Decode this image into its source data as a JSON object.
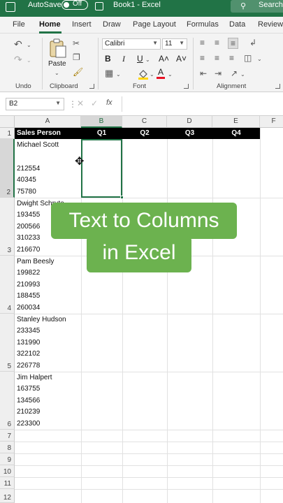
{
  "titlebar": {
    "autosave_label": "AutoSave",
    "toggle_state": "Off",
    "doc_title": "Book1  -  Excel",
    "search_label": "Search"
  },
  "tabs": [
    "File",
    "Home",
    "Insert",
    "Draw",
    "Page Layout",
    "Formulas",
    "Data",
    "Review"
  ],
  "active_tab": "Home",
  "ribbon": {
    "undo_group": "Undo",
    "clipboard_group": "Clipboard",
    "paste_label": "Paste",
    "font_group": "Font",
    "font_name": "Calibri",
    "font_size": "11",
    "bold": "B",
    "italic": "I",
    "underline": "U",
    "increase_font": "A˄",
    "decrease_font": "A˅",
    "alignment_group": "Alignment"
  },
  "formula_bar": {
    "name_box": "B2",
    "fx_label": "fx",
    "value": ""
  },
  "columns": [
    "A",
    "B",
    "C",
    "D",
    "E",
    "F"
  ],
  "selected_column": "B",
  "rows": [
    "1",
    "2",
    "3",
    "4",
    "5",
    "6",
    "7",
    "8",
    "9",
    "10",
    "11",
    "12"
  ],
  "selected_row": "2",
  "header_row": {
    "a": "Sales Person",
    "b": "Q1",
    "c": "Q2",
    "d": "Q3",
    "e": "Q4"
  },
  "cells": {
    "r2": [
      "Michael Scott",
      "",
      "212554",
      "40345",
      "75780"
    ],
    "r3": [
      "Dwight Schrute",
      "193455",
      "200566",
      "310233",
      "216670"
    ],
    "r4": [
      "Pam Beesly",
      "199822",
      "210993",
      "188455",
      "260034"
    ],
    "r5": [
      "Stanley Hudson",
      "233345",
      "131990",
      "322102",
      "226778"
    ],
    "r6": [
      "Jim Halpert",
      "163755",
      "134566",
      "210239",
      "223300"
    ]
  },
  "overlay": {
    "line1": "Text to Columns",
    "line2": "in Excel",
    "color": "#6cb24f"
  },
  "colors": {
    "excel_green": "#217346"
  }
}
